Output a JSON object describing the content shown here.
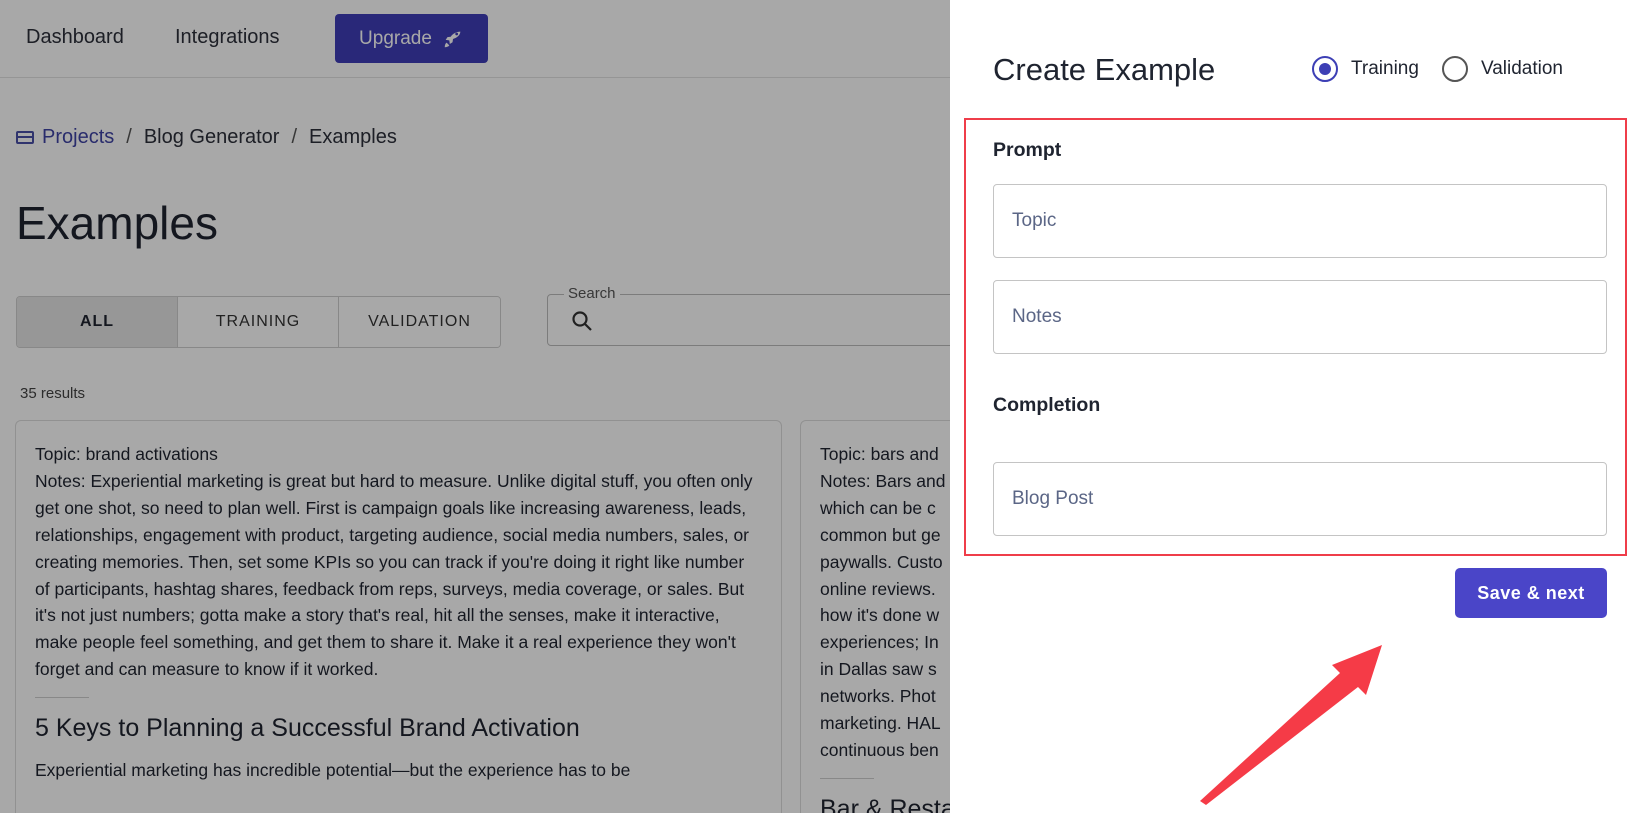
{
  "nav": {
    "dashboard": "Dashboard",
    "integrations": "Integrations",
    "upgrade": "Upgrade",
    "upgrade_icon": "rocket-icon"
  },
  "breadcrumb": {
    "icon": "browser-window-icon",
    "projects": "Projects",
    "sep1": "/",
    "project": "Blog Generator",
    "sep2": "/",
    "current": "Examples"
  },
  "page_title": "Examples",
  "filters": {
    "all": "ALL",
    "training": "TRAINING",
    "validation": "VALIDATION",
    "selected": "ALL"
  },
  "search": {
    "label": "Search",
    "icon": "search-icon"
  },
  "results": "35 results",
  "cards": [
    {
      "topic": "Topic: brand activations",
      "notes": "Notes: Experiential marketing is great but hard to measure. Unlike digital stuff, you often only get one shot, so need to plan well. First is campaign goals like increasing awareness, leads, relationships, engagement with product, targeting audience, social media numbers, sales, or creating memories. Then, set some KPIs so you can track if you're doing it right like number of participants, hashtag shares, feedback from reps, surveys, media coverage, or sales. But it's not just numbers; gotta make a story that's real, hit all the senses, make it interactive, make people feel something, and get them to share it. Make it a real experience they won't forget and can measure to know if it worked.",
      "heading": "5 Keys to Planning a Successful Brand Activation",
      "body": "Experiential marketing has incredible potential—but the experience has to be"
    },
    {
      "lines": "Topic: bars and\nNotes: Bars and\nwhich can be c\ncommon but ge\npaywalls. Custo\nonline reviews.\nhow it's done w\nexperiences; In\nin Dallas saw s\nnetworks. Phot\nmarketing. HAL\ncontinuous ben",
      "heading": "Bar & Resta"
    }
  ],
  "drawer": {
    "title": "Create Example",
    "radio_training": "Training",
    "radio_validation": "Validation",
    "selected": "Training",
    "prompt_label": "Prompt",
    "topic_placeholder": "Topic",
    "notes_placeholder": "Notes",
    "completion_label": "Completion",
    "blog_placeholder": "Blog Post",
    "save_label": "Save & next"
  },
  "colors": {
    "accent": "#4a45c8",
    "highlight": "#ef3d4a"
  }
}
